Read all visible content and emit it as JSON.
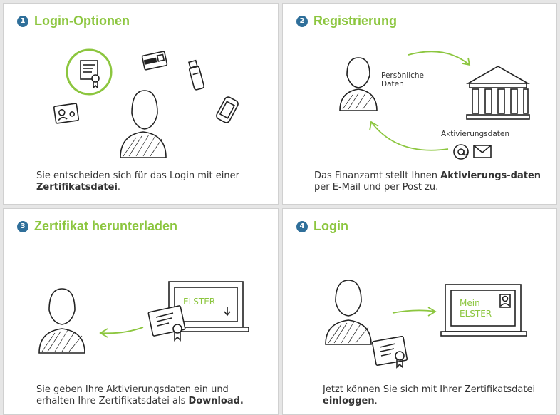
{
  "colors": {
    "accent": "#8cc63f",
    "badge": "#2f6f9a",
    "text": "#333333",
    "panel_bg": "#ffffff",
    "gap_bg": "#e6e6e6"
  },
  "panels": [
    {
      "number": "1",
      "title": "Login-Optionen",
      "desc_pre": "Sie entscheiden sich für das Login mit einer ",
      "desc_bold": "Zertifikatsdatei",
      "desc_post": "."
    },
    {
      "number": "2",
      "title": "Registrierung",
      "label_personal": [
        "Persönliche",
        "Daten"
      ],
      "label_activation": "Aktivierungsdaten",
      "desc_pre": "Das Finanzamt stellt Ihnen ",
      "desc_bold": "Aktivierungs-daten",
      "desc_post": " per E-Mail und per Post zu."
    },
    {
      "number": "3",
      "title": "Zertifikat herunterladen",
      "screen_label": "ELSTER",
      "desc_pre": "Sie geben Ihre Aktivierungsdaten ein und erhalten Ihre Zertifikatsdatei als ",
      "desc_bold": "Download.",
      "desc_post": ""
    },
    {
      "number": "4",
      "title": "Login",
      "screen_label": [
        "Mein",
        "ELSTER"
      ],
      "desc_pre": "Jetzt können Sie sich mit Ihrer Zertifikatsdatei ",
      "desc_bold": "einloggen",
      "desc_post": "."
    }
  ],
  "icons": [
    "certificate-icon",
    "smartcard-icon",
    "usb-stick-icon",
    "id-card-icon",
    "phone-icon",
    "person-icon",
    "bank-building-icon",
    "at-sign-icon",
    "envelope-icon",
    "laptop-icon",
    "arrow-icon"
  ]
}
